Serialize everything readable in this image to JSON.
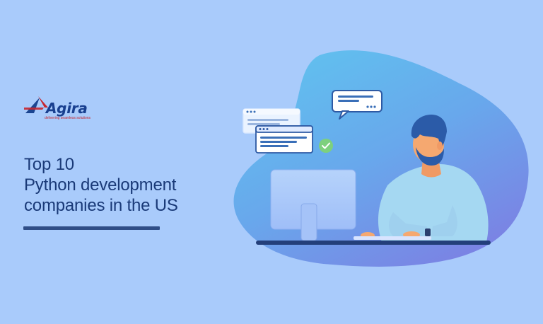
{
  "logo": {
    "name": "Agira",
    "tagline": "delivering seamless solutions"
  },
  "headline": {
    "line1": "Top 10",
    "line2": "Python development",
    "line3": "companies in the US"
  },
  "colors": {
    "background": "#a9cbfb",
    "blob_start": "#6bc8ee",
    "blob_end": "#6f8de6",
    "text": "#1a3a78",
    "accent": "#2f4e87",
    "check": "#7dd07e",
    "skin": "#f5a870",
    "hair": "#2b5ba8",
    "shirt": "#a5d8f2"
  },
  "icons": [
    "agira-logo-icon",
    "chat-bubble-icon",
    "browser-window-icon",
    "check-icon",
    "monitor-icon",
    "person-illustration"
  ]
}
